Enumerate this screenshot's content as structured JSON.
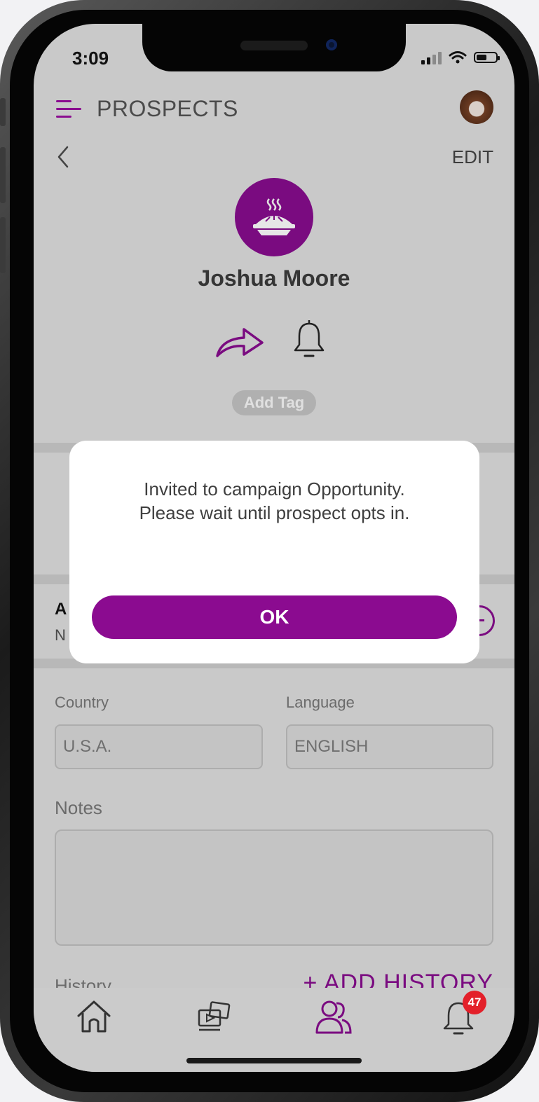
{
  "status_bar": {
    "time": "3:09"
  },
  "header": {
    "title": "PROSPECTS"
  },
  "nav": {
    "edit_label": "EDIT"
  },
  "profile": {
    "name": "Joshua Moore",
    "add_tag_label": "Add Tag"
  },
  "dialog": {
    "message_line1": "Invited to campaign Opportunity.",
    "message_line2": "Please wait until prospect opts in.",
    "ok_label": "OK"
  },
  "campaign_row": {
    "title_partial": "A",
    "subtitle_partial": "N"
  },
  "form": {
    "country_label": "Country",
    "country_value": "U.S.A.",
    "language_label": "Language",
    "language_value": "ENGLISH",
    "notes_label": "Notes"
  },
  "history": {
    "label": "History",
    "add_label": "+ ADD HISTORY"
  },
  "tabbar": {
    "items": [
      "home-icon",
      "media-icon",
      "people-icon",
      "notifications-icon"
    ],
    "notification_count": "47"
  },
  "colors": {
    "accent": "#8b0b90",
    "overlay": "#c9c9c9",
    "badge": "#e3202a"
  }
}
